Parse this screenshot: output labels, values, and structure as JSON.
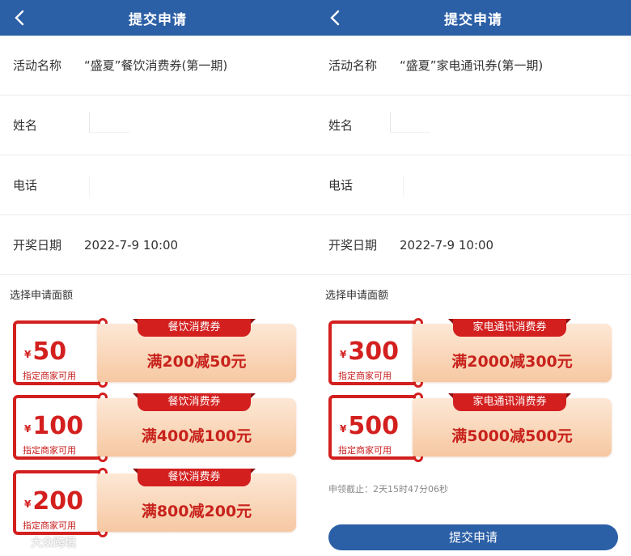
{
  "colors": {
    "header_bg": "#2b5fa6",
    "accent_red": "#d3201f",
    "coupon_bg": "#f6c8a2"
  },
  "panels": [
    {
      "header": {
        "title": "提交申请",
        "back_icon": "chevron-left-icon"
      },
      "fields": [
        {
          "label": "活动名称",
          "value": "“盛夏”餐饮消费券(第一期)"
        },
        {
          "label": "姓名",
          "value": ""
        },
        {
          "label": "电话",
          "value": ""
        },
        {
          "label": "开奖日期",
          "value": "2022-7-9 10:00"
        }
      ],
      "section_title": "选择申请面额",
      "coupons": [
        {
          "currency": "¥",
          "amount": "50",
          "note": "指定商家可用",
          "ribbon": "餐饮消费券",
          "rule": "满200减50元"
        },
        {
          "currency": "¥",
          "amount": "100",
          "note": "指定商家可用",
          "ribbon": "餐饮消费券",
          "rule": "满400减100元"
        },
        {
          "currency": "¥",
          "amount": "200",
          "note": "指定商家可用",
          "ribbon": "餐饮消费券",
          "rule": "满800减200元"
        }
      ]
    },
    {
      "header": {
        "title": "提交申请",
        "back_icon": "chevron-left-icon"
      },
      "fields": [
        {
          "label": "活动名称",
          "value": "“盛夏”家电通讯券(第一期)"
        },
        {
          "label": "姓名",
          "value": ""
        },
        {
          "label": "电话",
          "value": ""
        },
        {
          "label": "开奖日期",
          "value": "2022-7-9 10:00"
        }
      ],
      "section_title": "选择申请面额",
      "coupons": [
        {
          "currency": "¥",
          "amount": "300",
          "note": "指定商家可用",
          "ribbon": "家电通讯消费券",
          "rule": "满2000减300元"
        },
        {
          "currency": "¥",
          "amount": "500",
          "note": "指定商家可用",
          "ribbon": "家电通讯消费券",
          "rule": "满5000减500元"
        }
      ],
      "deadline": "申领截止：2天15时47分06秒",
      "submit_label": "提交申请"
    }
  ],
  "watermark": "大众跨境"
}
